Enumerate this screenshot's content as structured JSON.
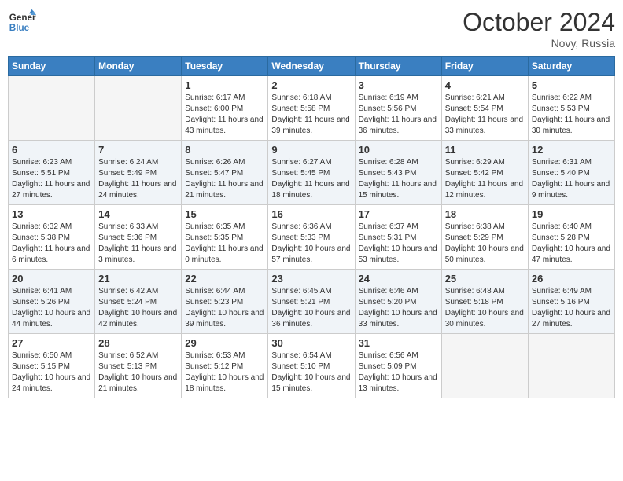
{
  "header": {
    "logo_line1": "General",
    "logo_line2": "Blue",
    "month": "October 2024",
    "location": "Novy, Russia"
  },
  "weekdays": [
    "Sunday",
    "Monday",
    "Tuesday",
    "Wednesday",
    "Thursday",
    "Friday",
    "Saturday"
  ],
  "weeks": [
    [
      {
        "day": "",
        "info": ""
      },
      {
        "day": "",
        "info": ""
      },
      {
        "day": "1",
        "info": "Sunrise: 6:17 AM\nSunset: 6:00 PM\nDaylight: 11 hours and 43 minutes."
      },
      {
        "day": "2",
        "info": "Sunrise: 6:18 AM\nSunset: 5:58 PM\nDaylight: 11 hours and 39 minutes."
      },
      {
        "day": "3",
        "info": "Sunrise: 6:19 AM\nSunset: 5:56 PM\nDaylight: 11 hours and 36 minutes."
      },
      {
        "day": "4",
        "info": "Sunrise: 6:21 AM\nSunset: 5:54 PM\nDaylight: 11 hours and 33 minutes."
      },
      {
        "day": "5",
        "info": "Sunrise: 6:22 AM\nSunset: 5:53 PM\nDaylight: 11 hours and 30 minutes."
      }
    ],
    [
      {
        "day": "6",
        "info": "Sunrise: 6:23 AM\nSunset: 5:51 PM\nDaylight: 11 hours and 27 minutes."
      },
      {
        "day": "7",
        "info": "Sunrise: 6:24 AM\nSunset: 5:49 PM\nDaylight: 11 hours and 24 minutes."
      },
      {
        "day": "8",
        "info": "Sunrise: 6:26 AM\nSunset: 5:47 PM\nDaylight: 11 hours and 21 minutes."
      },
      {
        "day": "9",
        "info": "Sunrise: 6:27 AM\nSunset: 5:45 PM\nDaylight: 11 hours and 18 minutes."
      },
      {
        "day": "10",
        "info": "Sunrise: 6:28 AM\nSunset: 5:43 PM\nDaylight: 11 hours and 15 minutes."
      },
      {
        "day": "11",
        "info": "Sunrise: 6:29 AM\nSunset: 5:42 PM\nDaylight: 11 hours and 12 minutes."
      },
      {
        "day": "12",
        "info": "Sunrise: 6:31 AM\nSunset: 5:40 PM\nDaylight: 11 hours and 9 minutes."
      }
    ],
    [
      {
        "day": "13",
        "info": "Sunrise: 6:32 AM\nSunset: 5:38 PM\nDaylight: 11 hours and 6 minutes."
      },
      {
        "day": "14",
        "info": "Sunrise: 6:33 AM\nSunset: 5:36 PM\nDaylight: 11 hours and 3 minutes."
      },
      {
        "day": "15",
        "info": "Sunrise: 6:35 AM\nSunset: 5:35 PM\nDaylight: 11 hours and 0 minutes."
      },
      {
        "day": "16",
        "info": "Sunrise: 6:36 AM\nSunset: 5:33 PM\nDaylight: 10 hours and 57 minutes."
      },
      {
        "day": "17",
        "info": "Sunrise: 6:37 AM\nSunset: 5:31 PM\nDaylight: 10 hours and 53 minutes."
      },
      {
        "day": "18",
        "info": "Sunrise: 6:38 AM\nSunset: 5:29 PM\nDaylight: 10 hours and 50 minutes."
      },
      {
        "day": "19",
        "info": "Sunrise: 6:40 AM\nSunset: 5:28 PM\nDaylight: 10 hours and 47 minutes."
      }
    ],
    [
      {
        "day": "20",
        "info": "Sunrise: 6:41 AM\nSunset: 5:26 PM\nDaylight: 10 hours and 44 minutes."
      },
      {
        "day": "21",
        "info": "Sunrise: 6:42 AM\nSunset: 5:24 PM\nDaylight: 10 hours and 42 minutes."
      },
      {
        "day": "22",
        "info": "Sunrise: 6:44 AM\nSunset: 5:23 PM\nDaylight: 10 hours and 39 minutes."
      },
      {
        "day": "23",
        "info": "Sunrise: 6:45 AM\nSunset: 5:21 PM\nDaylight: 10 hours and 36 minutes."
      },
      {
        "day": "24",
        "info": "Sunrise: 6:46 AM\nSunset: 5:20 PM\nDaylight: 10 hours and 33 minutes."
      },
      {
        "day": "25",
        "info": "Sunrise: 6:48 AM\nSunset: 5:18 PM\nDaylight: 10 hours and 30 minutes."
      },
      {
        "day": "26",
        "info": "Sunrise: 6:49 AM\nSunset: 5:16 PM\nDaylight: 10 hours and 27 minutes."
      }
    ],
    [
      {
        "day": "27",
        "info": "Sunrise: 6:50 AM\nSunset: 5:15 PM\nDaylight: 10 hours and 24 minutes."
      },
      {
        "day": "28",
        "info": "Sunrise: 6:52 AM\nSunset: 5:13 PM\nDaylight: 10 hours and 21 minutes."
      },
      {
        "day": "29",
        "info": "Sunrise: 6:53 AM\nSunset: 5:12 PM\nDaylight: 10 hours and 18 minutes."
      },
      {
        "day": "30",
        "info": "Sunrise: 6:54 AM\nSunset: 5:10 PM\nDaylight: 10 hours and 15 minutes."
      },
      {
        "day": "31",
        "info": "Sunrise: 6:56 AM\nSunset: 5:09 PM\nDaylight: 10 hours and 13 minutes."
      },
      {
        "day": "",
        "info": ""
      },
      {
        "day": "",
        "info": ""
      }
    ]
  ]
}
